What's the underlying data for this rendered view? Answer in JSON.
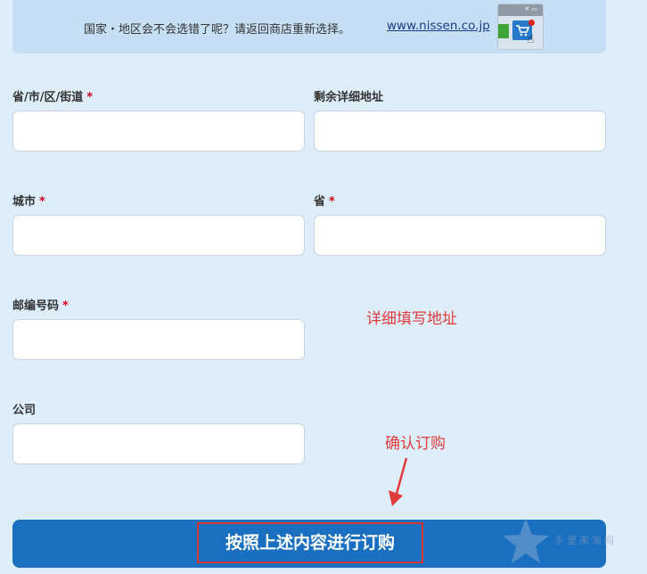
{
  "notice": {
    "text": "国家・地区会不会选错了呢？请返回商店重新选择。",
    "link": "www.nissen.co.jp"
  },
  "form": {
    "address_line": {
      "label": "省/市/区/街道",
      "required_mark": "*"
    },
    "address_rest": {
      "label": "剩余详细地址"
    },
    "city": {
      "label": "城市",
      "required_mark": "*"
    },
    "province": {
      "label": "省",
      "required_mark": "*"
    },
    "postal_code": {
      "label": "邮编号码",
      "required_mark": "*"
    },
    "company": {
      "label": "公司"
    }
  },
  "annotations": {
    "fill_address": "详细填写地址",
    "confirm": "确认订购"
  },
  "submit": {
    "label": "按照上述内容进行订购"
  },
  "watermark": {
    "text": "手里来淘网"
  },
  "colors": {
    "accent": "#1a6fc0",
    "annotation": "#e03b3b",
    "required": "#d0021b"
  }
}
